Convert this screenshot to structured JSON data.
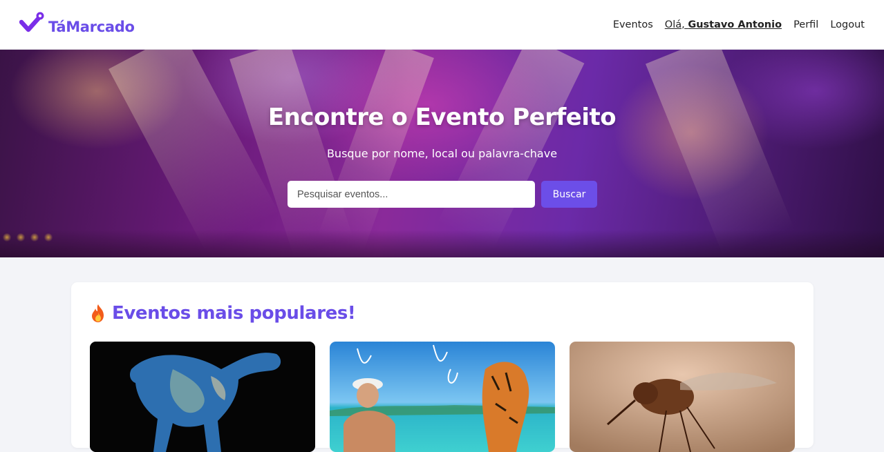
{
  "header": {
    "brand": "TáMarcado",
    "nav": {
      "eventos": "Eventos",
      "greeting_prefix": "Olá,",
      "user_name": "Gustavo Antonio",
      "perfil": "Perfil",
      "logout": "Logout"
    }
  },
  "hero": {
    "title": "Encontre o Evento Perfeito",
    "subtitle": "Busque por nome, local ou palavra-chave",
    "search_placeholder": "Pesquisar eventos...",
    "search_button": "Buscar"
  },
  "popular": {
    "title": "Eventos mais populares!",
    "icon": "fire-icon",
    "events": [
      {
        "image": "dinosaur-image"
      },
      {
        "image": "beach-tiger-image"
      },
      {
        "image": "mosquito-image"
      }
    ]
  },
  "colors": {
    "brand": "#6a4de8",
    "button": "#6c4ee8",
    "page_bg": "#f3f4f8"
  }
}
